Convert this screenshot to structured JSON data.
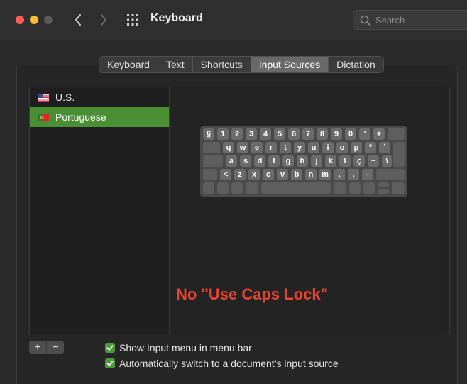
{
  "window": {
    "title": "Keyboard",
    "search_placeholder": "Search"
  },
  "tabs": [
    {
      "label": "Keyboard",
      "active": false
    },
    {
      "label": "Text",
      "active": false
    },
    {
      "label": "Shortcuts",
      "active": false
    },
    {
      "label": "Input Sources",
      "active": true
    },
    {
      "label": "Dictation",
      "active": false
    }
  ],
  "sources": [
    {
      "label": "U.S.",
      "flag": "us-flag-icon",
      "selected": false
    },
    {
      "label": "Portuguese",
      "flag": "portugal-flag-icon",
      "selected": true
    }
  ],
  "keyboard": {
    "row1": [
      "§",
      "1",
      "2",
      "3",
      "4",
      "5",
      "6",
      "7",
      "8",
      "9",
      "0",
      "'",
      "+"
    ],
    "row2": [
      "q",
      "w",
      "e",
      "r",
      "t",
      "y",
      "u",
      "i",
      "o",
      "p",
      "º",
      "´"
    ],
    "row3": [
      "a",
      "s",
      "d",
      "f",
      "g",
      "h",
      "j",
      "k",
      "l",
      "ç",
      "~",
      "\\"
    ],
    "row4": [
      "<",
      "z",
      "x",
      "c",
      "v",
      "b",
      "n",
      "m",
      ",",
      ".",
      "-"
    ]
  },
  "annotation": "No \"Use Caps Lock\"",
  "buttons": {
    "add": "+",
    "remove": "−"
  },
  "options": {
    "show_menu": "Show Input menu in menu bar",
    "auto_switch": "Automatically switch to a document’s input source"
  },
  "colors": {
    "selection": "#4a8f33",
    "checkbox": "#4a9c3a",
    "annotation": "#e8442e"
  }
}
